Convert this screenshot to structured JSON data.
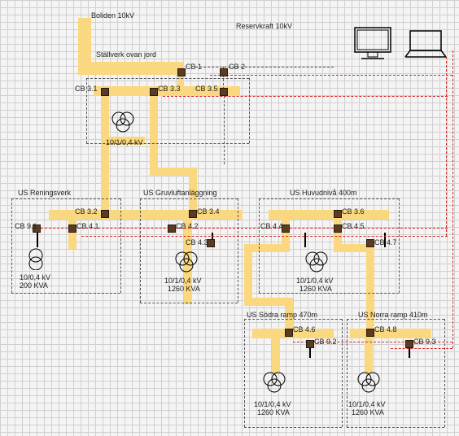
{
  "sources": {
    "main": "Boliden 10kV",
    "reserve": "Reservkraft 10kV"
  },
  "stations": {
    "ovan": "Ställverk ovan jord",
    "reningsverk": "US Reningsverk",
    "gruvluft": "US Gruvluftanläggning",
    "huvudniva": "US Huvudnivå 400m",
    "sodra": "US Södra ramp 470m",
    "norra": "US Norra ramp 410m"
  },
  "breakers": {
    "cb1": "CB 1",
    "cb2": "CB 2",
    "cb31": "CB 3.1",
    "cb33": "CB 3.3",
    "cb35": "CB 3.5",
    "cb32": "CB 3.2",
    "cb34": "CB 3.4",
    "cb36": "CB 3.6",
    "cb41": "CB 4.1",
    "cb42": "CB 4.2",
    "cb43": "CB 4.3",
    "cb44": "CB 4.4",
    "cb45": "CB 4.5",
    "cb47": "CB 4.7",
    "cb46": "CB 4.6",
    "cb48": "CB 4.8",
    "cb91": "CB 9.1",
    "cb92": "CB 9.2",
    "cb93": "CB 9.3"
  },
  "transformers": {
    "t1": {
      "ratio": "10/1/0,4 kV",
      "rating": ""
    },
    "t2": {
      "ratio": "10/0,4 kV",
      "rating": "200 KVA"
    },
    "t3": {
      "ratio": "10/1/0,4 kV",
      "rating": "1260 KVA"
    },
    "t4": {
      "ratio": "10/1/0,4 kV",
      "rating": "1260 KVA"
    },
    "t5": {
      "ratio": "10/1/0,4 kV",
      "rating": "1260 KVA"
    },
    "t6": {
      "ratio": "10/1/0,4 kV",
      "rating": "1260 KVA"
    }
  }
}
